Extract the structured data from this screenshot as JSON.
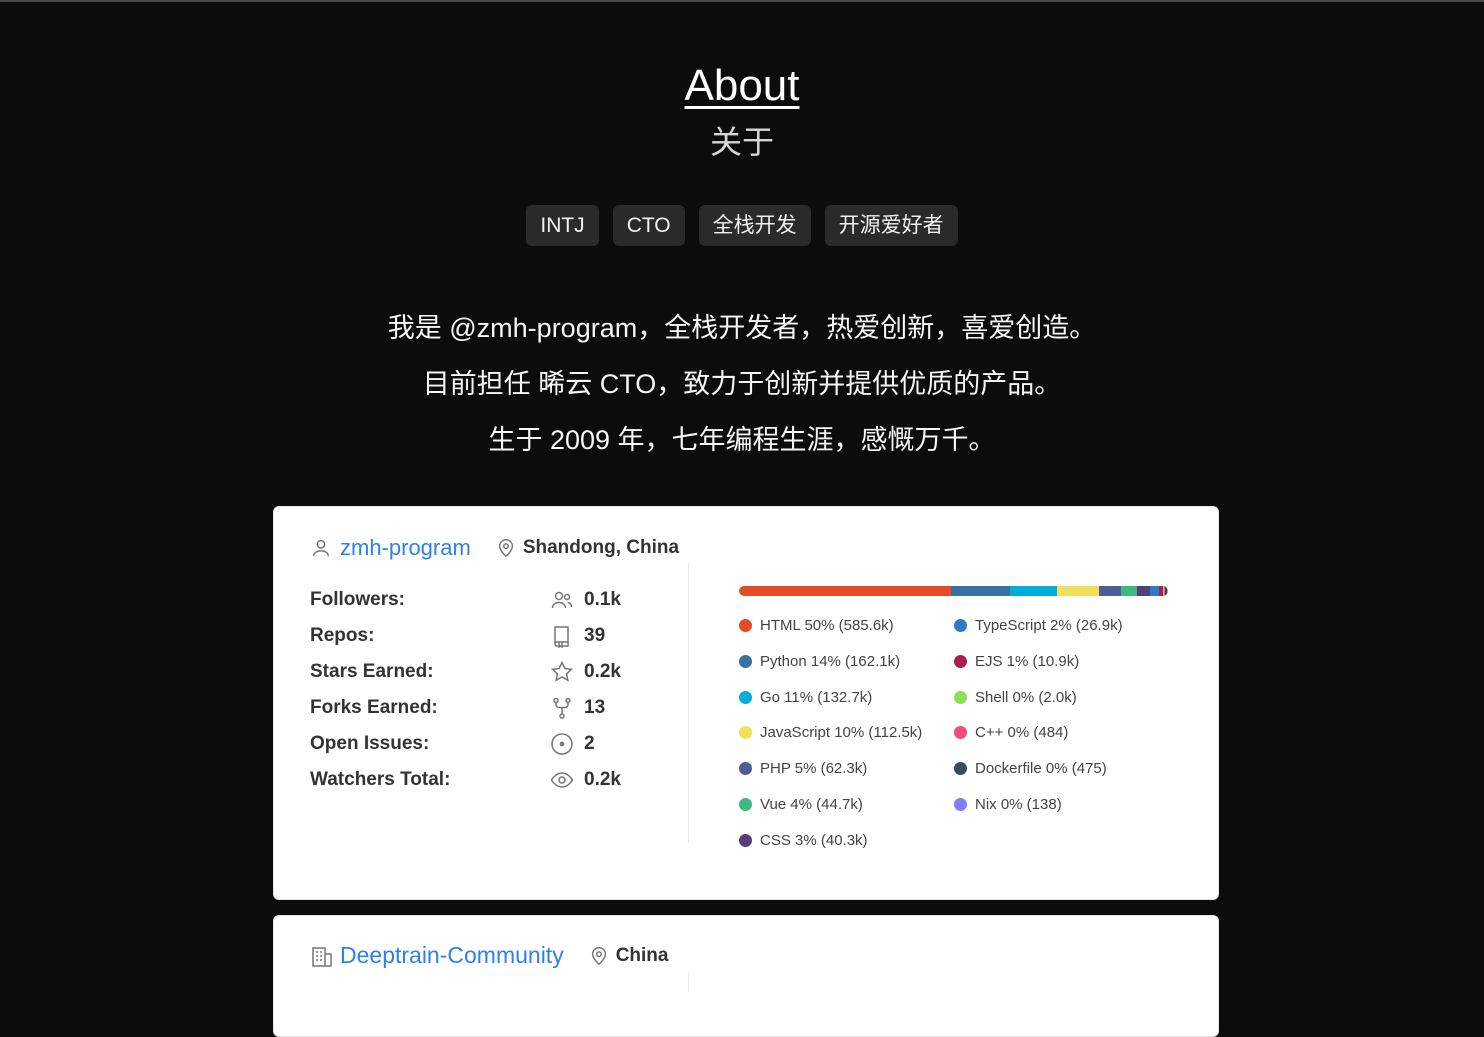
{
  "page": {
    "title": "About",
    "subtitle": "关于",
    "tags": [
      "INTJ",
      "CTO",
      "全栈开发",
      "开源爱好者"
    ],
    "intro_lines": [
      "我是 @zmh-program，全栈开发者，热爱创新，喜爱创造。",
      "目前担任 晞云 CTO，致力于创新并提供优质的产品。",
      "生于 2009 年，七年编程生涯，感慨万千。"
    ]
  },
  "profile_card": {
    "username": "zmh-program",
    "location": "Shandong, China",
    "stats": [
      {
        "label": "Followers:",
        "value": "0.1k",
        "icon": "users-icon"
      },
      {
        "label": "Repos:",
        "value": "39",
        "icon": "repo-icon"
      },
      {
        "label": "Stars Earned:",
        "value": "0.2k",
        "icon": "star-icon"
      },
      {
        "label": "Forks Earned:",
        "value": "13",
        "icon": "fork-icon"
      },
      {
        "label": "Open Issues:",
        "value": "2",
        "icon": "issue-icon"
      },
      {
        "label": "Watchers Total:",
        "value": "0.2k",
        "icon": "eye-icon"
      }
    ],
    "languages": [
      {
        "label": "HTML 50% (585.6k)",
        "color": "#e34c26",
        "share": 50
      },
      {
        "label": "Python 14% (162.1k)",
        "color": "#3572A5",
        "share": 14
      },
      {
        "label": "Go 11% (132.7k)",
        "color": "#00ADD8",
        "share": 11
      },
      {
        "label": "JavaScript 10% (112.5k)",
        "color": "#f1e05a",
        "share": 10
      },
      {
        "label": "PHP 5% (62.3k)",
        "color": "#4F5D95",
        "share": 5
      },
      {
        "label": "Vue 4% (44.7k)",
        "color": "#41b883",
        "share": 4
      },
      {
        "label": "CSS 3% (40.3k)",
        "color": "#563d7c",
        "share": 3
      },
      {
        "label": "TypeScript 2% (26.9k)",
        "color": "#3178c6",
        "share": 2
      },
      {
        "label": "EJS 1% (10.9k)",
        "color": "#a91e50",
        "share": 1
      },
      {
        "label": "Shell 0% (2.0k)",
        "color": "#89e051",
        "share": 0
      },
      {
        "label": "C++ 0% (484)",
        "color": "#f34b7d",
        "share": 0
      },
      {
        "label": "Dockerfile 0% (475)",
        "color": "#384d54",
        "share": 0
      },
      {
        "label": "Nix 0% (138)",
        "color": "#7e7eff",
        "share": 0
      }
    ]
  },
  "org_card": {
    "name": "Deeptrain-Community",
    "location": "China"
  }
}
